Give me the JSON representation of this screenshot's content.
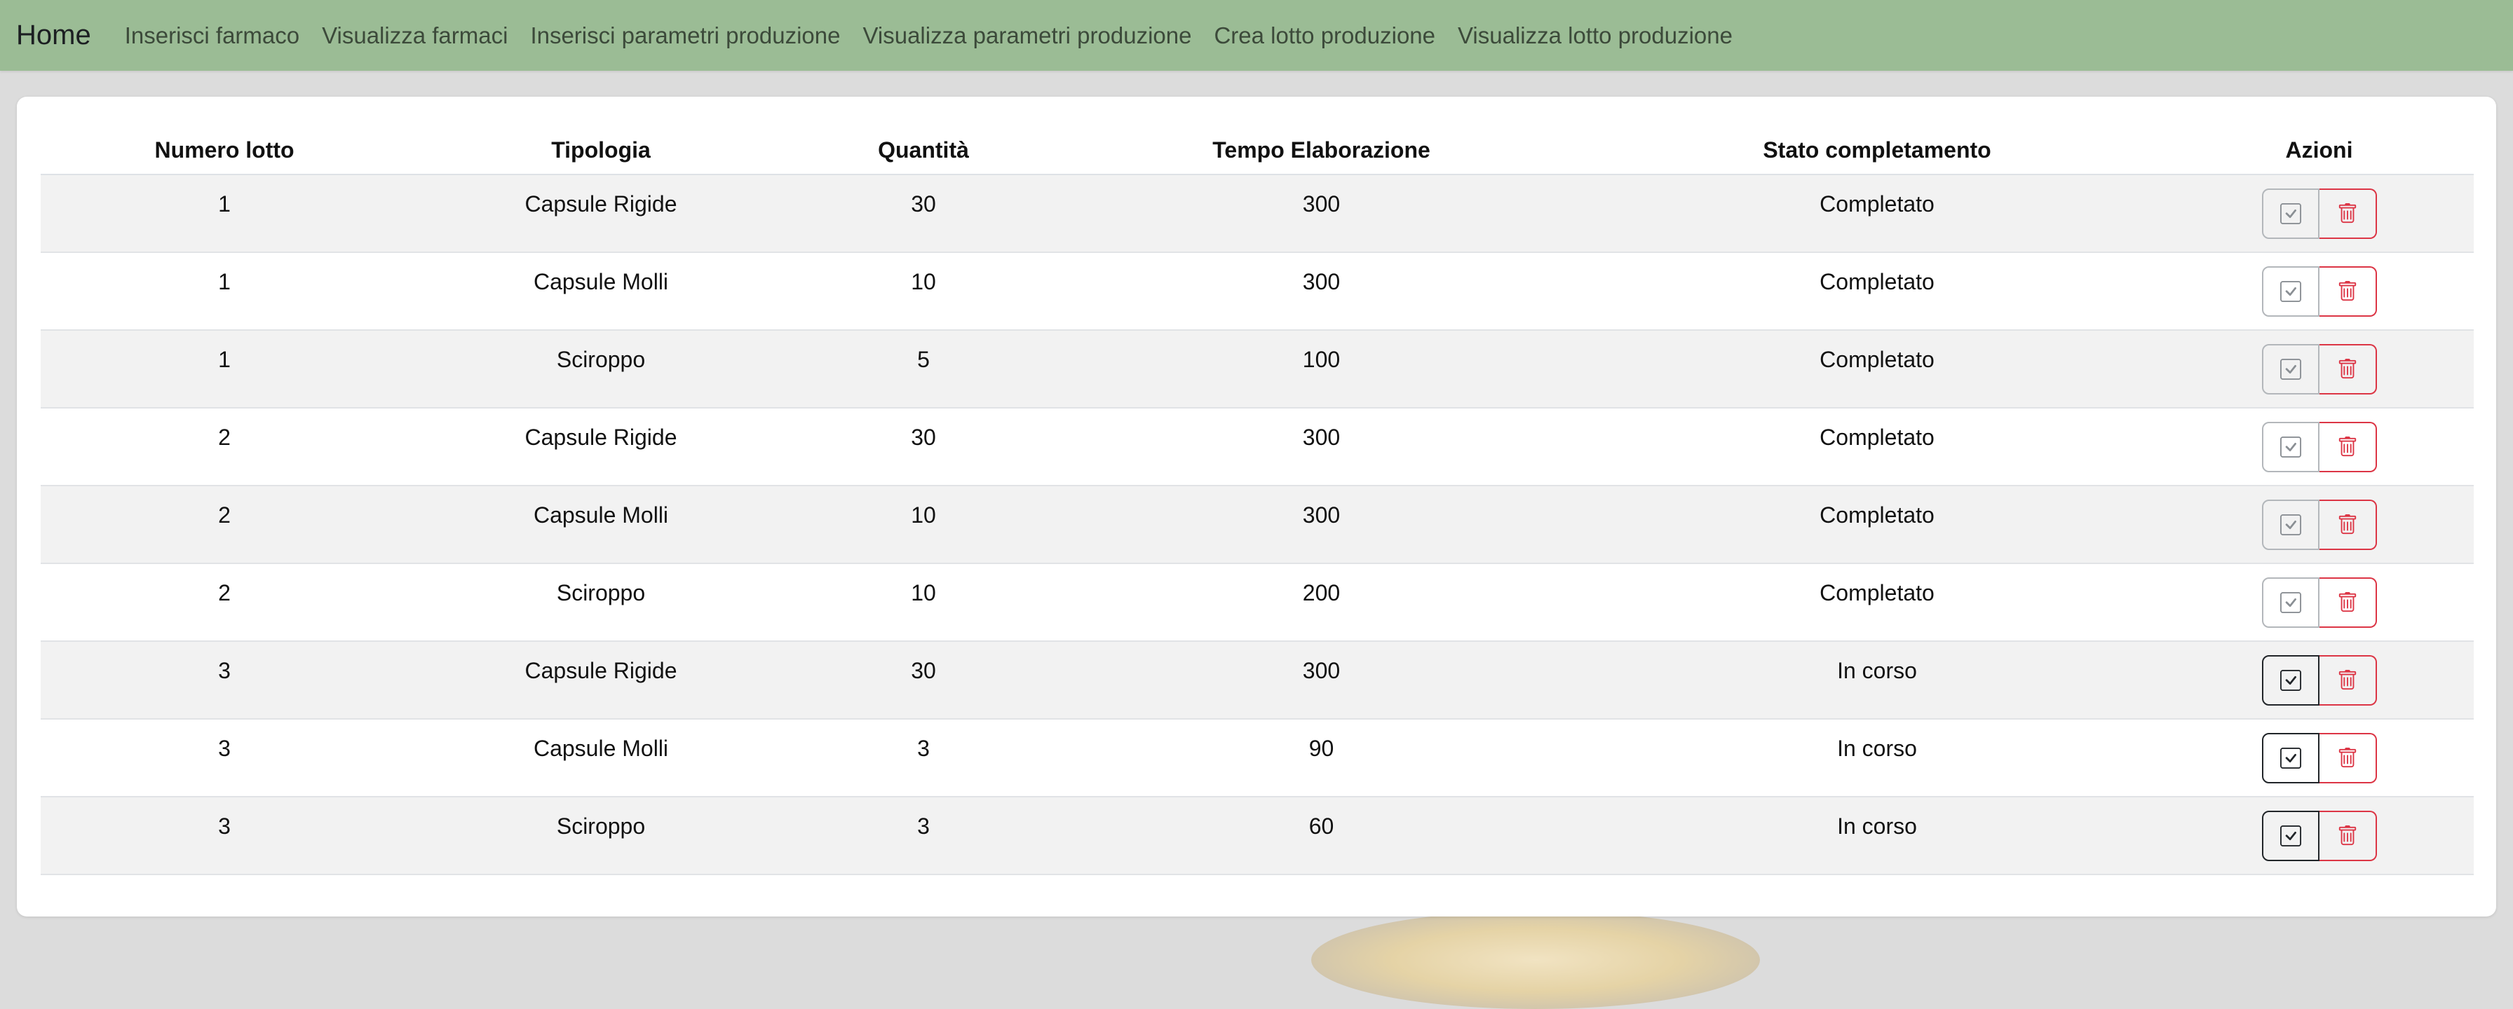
{
  "navbar": {
    "brand": "Home",
    "links": [
      "Inserisci farmaco",
      "Visualizza farmaci",
      "Inserisci parametri produzione",
      "Visualizza parametri produzione",
      "Crea lotto produzione",
      "Visualizza lotto produzione"
    ]
  },
  "table": {
    "headers": [
      "Numero lotto",
      "Tipologia",
      "Quantità",
      "Tempo Elaborazione",
      "Stato completamento",
      "Azioni"
    ],
    "rows": [
      {
        "lotto": "1",
        "tipologia": "Capsule Rigide",
        "quantita": "30",
        "tempo": "300",
        "stato": "Completato",
        "check_enabled": false
      },
      {
        "lotto": "1",
        "tipologia": "Capsule Molli",
        "quantita": "10",
        "tempo": "300",
        "stato": "Completato",
        "check_enabled": false
      },
      {
        "lotto": "1",
        "tipologia": "Sciroppo",
        "quantita": "5",
        "tempo": "100",
        "stato": "Completato",
        "check_enabled": false
      },
      {
        "lotto": "2",
        "tipologia": "Capsule Rigide",
        "quantita": "30",
        "tempo": "300",
        "stato": "Completato",
        "check_enabled": false
      },
      {
        "lotto": "2",
        "tipologia": "Capsule Molli",
        "quantita": "10",
        "tempo": "300",
        "stato": "Completato",
        "check_enabled": false
      },
      {
        "lotto": "2",
        "tipologia": "Sciroppo",
        "quantita": "10",
        "tempo": "200",
        "stato": "Completato",
        "check_enabled": false
      },
      {
        "lotto": "3",
        "tipologia": "Capsule Rigide",
        "quantita": "30",
        "tempo": "300",
        "stato": "In corso",
        "check_enabled": true
      },
      {
        "lotto": "3",
        "tipologia": "Capsule Molli",
        "quantita": "3",
        "tempo": "90",
        "stato": "In corso",
        "check_enabled": true
      },
      {
        "lotto": "3",
        "tipologia": "Sciroppo",
        "quantita": "3",
        "tempo": "60",
        "stato": "In corso",
        "check_enabled": true
      }
    ]
  },
  "icons": {
    "complete": "check-square-icon",
    "delete": "trash-icon"
  },
  "colors": {
    "navbar": "#9bbc95",
    "danger": "#dc3545",
    "check_disabled": "#b3b7bb",
    "check_enabled": "#212529",
    "row_stripe": "#f2f2f2"
  }
}
